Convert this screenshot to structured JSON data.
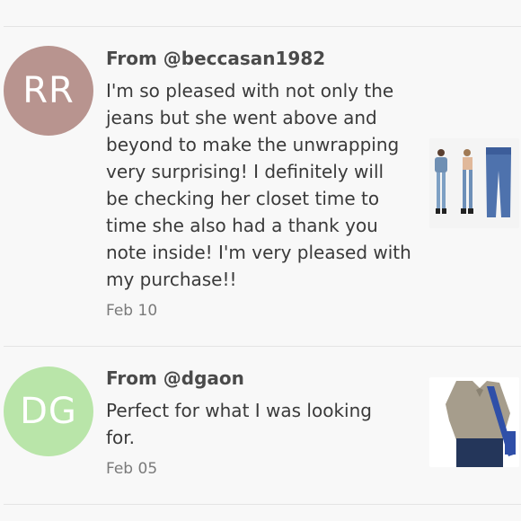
{
  "reviews": [
    {
      "initials": "RR",
      "avatar_color": "#b8948f",
      "from": "From @beccasan1982",
      "text": "I'm so pleased with not only the jeans but she went above and beyond to make the unwrapping very surprising! I definitely will be checking her closet time to time she also had a thank you note inside! I'm very pleased with my purchase!!",
      "date": "Feb 10",
      "thumbnail_icon": "jeans-outfit-photo"
    },
    {
      "initials": "DG",
      "avatar_color": "#b9e5a9",
      "from": "From @dgaon",
      "text": "Perfect for what I was looking for.",
      "date": "Feb 05",
      "thumbnail_icon": "sweater-photo"
    }
  ]
}
